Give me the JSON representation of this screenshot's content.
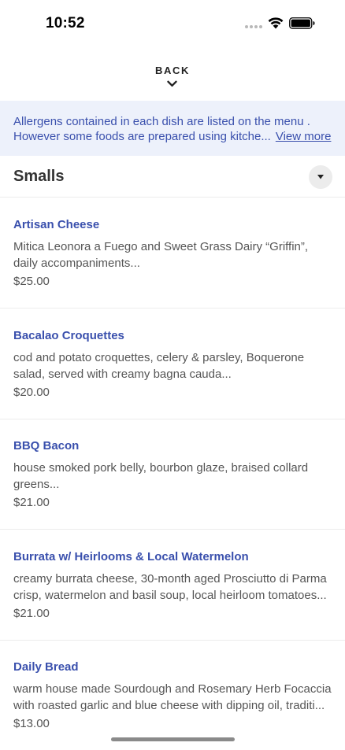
{
  "status_bar": {
    "time": "10:52"
  },
  "navigation": {
    "back_label": "BACK"
  },
  "allergen_notice": {
    "line1": "Allergens contained in each dish are listed on the menu .",
    "line2": "However some foods are prepared using kitche...",
    "view_more_label": "View more"
  },
  "section": {
    "title": "Smalls"
  },
  "menu_items": [
    {
      "name": "Artisan Cheese",
      "description_lines": [
        "Mitica Leonora a Fuego and Sweet Grass Dairy “Griffin”,",
        "daily accompaniments..."
      ],
      "price": "$25.00"
    },
    {
      "name": "Bacalao Croquettes",
      "description_lines": [
        "cod and potato croquettes, celery & parsley, Boquerone",
        "salad, served with creamy bagna cauda..."
      ],
      "price": "$20.00"
    },
    {
      "name": "BBQ Bacon",
      "description_lines": [
        "house smoked pork belly, bourbon glaze, braised collard",
        "greens..."
      ],
      "price": "$21.00"
    },
    {
      "name": "Burrata w/ Heirlooms & Local Watermelon",
      "description_lines": [
        "creamy burrata cheese, 30-month aged Prosciutto di Parma",
        "crisp, watermelon and basil soup, local heirloom tomatoes..."
      ],
      "price": "$21.00"
    },
    {
      "name": "Daily Bread",
      "description_lines": [
        "warm house made Sourdough and Rosemary Herb Focaccia",
        "with roasted garlic and blue cheese with dipping oil, traditi..."
      ],
      "price": "$13.00"
    }
  ],
  "colors": {
    "accent_blue": "#3a50ad",
    "banner_background": "#edf1fb",
    "divider": "#ececec"
  }
}
